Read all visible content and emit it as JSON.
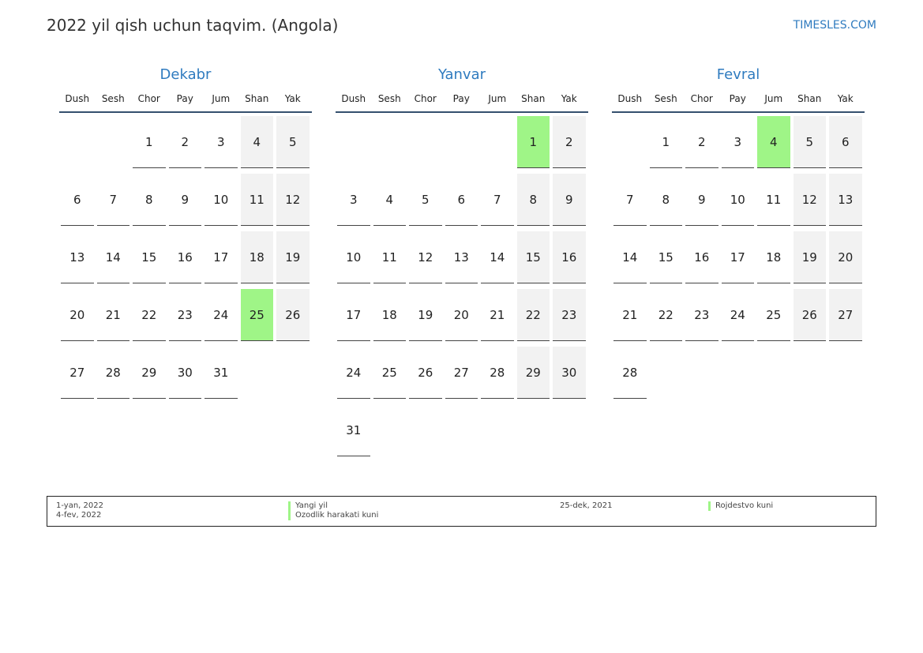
{
  "header": {
    "title": "2022 yil qish uchun taqvim. (Angola)",
    "site": "TIMESLES.COM"
  },
  "weekdays": [
    "Dush",
    "Sesh",
    "Chor",
    "Pay",
    "Jum",
    "Shan",
    "Yak"
  ],
  "months": [
    {
      "name": "Dekabr",
      "offset": 2,
      "days": 31,
      "holidays": [
        25
      ]
    },
    {
      "name": "Yanvar",
      "offset": 5,
      "days": 31,
      "holidays": [
        1
      ]
    },
    {
      "name": "Fevral",
      "offset": 1,
      "days": 28,
      "holidays": [
        4
      ]
    }
  ],
  "legend": [
    {
      "date": "1-yan, 2022",
      "name": "Yangi yil"
    },
    {
      "date": "4-fev, 2022",
      "name": "Ozodlik harakati kuni"
    },
    {
      "date": "25-dek, 2021",
      "name": "Rojdestvo kuni"
    }
  ]
}
